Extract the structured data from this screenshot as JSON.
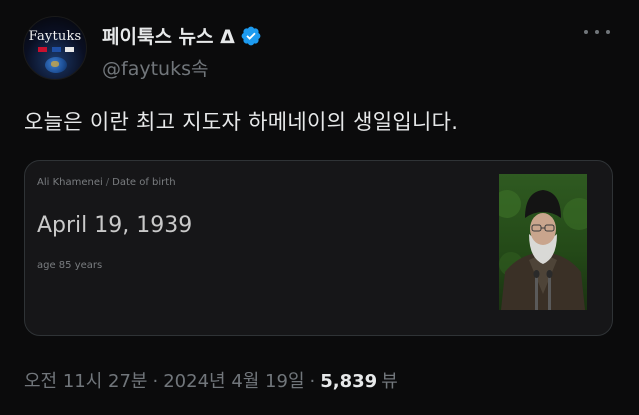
{
  "author": {
    "avatar_text": "Faytuks",
    "display_name": "페이툭스 뉴스 Δ",
    "handle": "@faytuks속",
    "verified_icon": "verified-badge-icon"
  },
  "tweet": {
    "text": "오늘은 이란 최고 지도자 하메네이의 생일입니다."
  },
  "card": {
    "breadcrumb_subject": "Ali Khamenei",
    "breadcrumb_separator": "/",
    "breadcrumb_field": "Date of birth",
    "value": "April 19, 1939",
    "subtext": "age 85 years",
    "image_icon": "portrait-photo"
  },
  "meta": {
    "time": "오전 11시 27분",
    "separator": "·",
    "date": "2024년 4월 19일",
    "views_count": "5,839",
    "views_label": "뷰"
  },
  "colors": {
    "background": "#0b0b0c",
    "primary_text": "#e7e9ea",
    "secondary_text": "#71767b",
    "verified_blue": "#1d9bf0",
    "card_border": "#2f3336"
  }
}
